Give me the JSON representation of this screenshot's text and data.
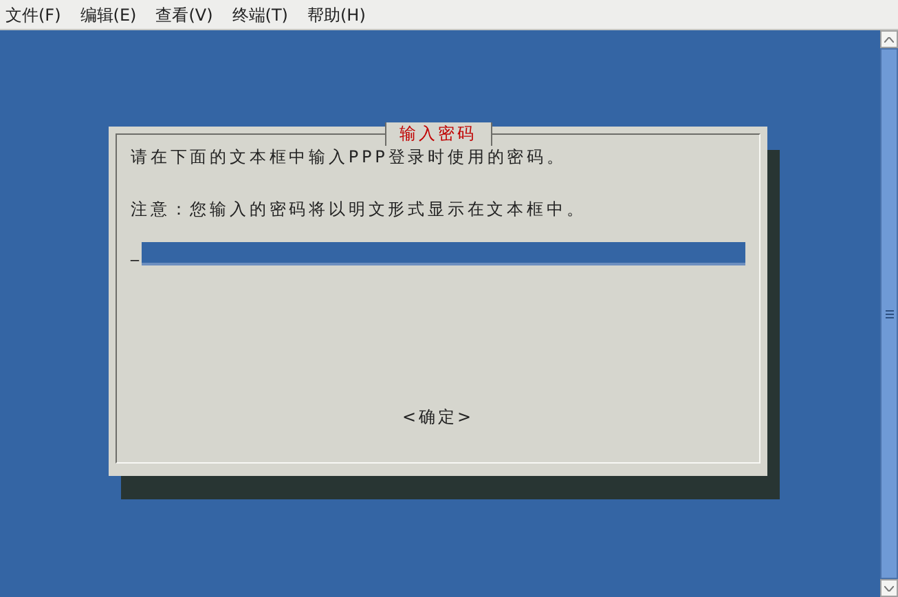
{
  "menu": [
    {
      "label": "文件(F)"
    },
    {
      "label": "编辑(E)"
    },
    {
      "label": "查看(V)"
    },
    {
      "label": "终端(T)"
    },
    {
      "label": "帮助(H)"
    }
  ],
  "dialog": {
    "title": "输入密码",
    "lines": [
      "请在下面的文本框中输入PPP登录时使用的密码。",
      "注意：您输入的密码将以明文形式显示在文本框中。"
    ],
    "cursor": "_",
    "button": "<确定>"
  }
}
